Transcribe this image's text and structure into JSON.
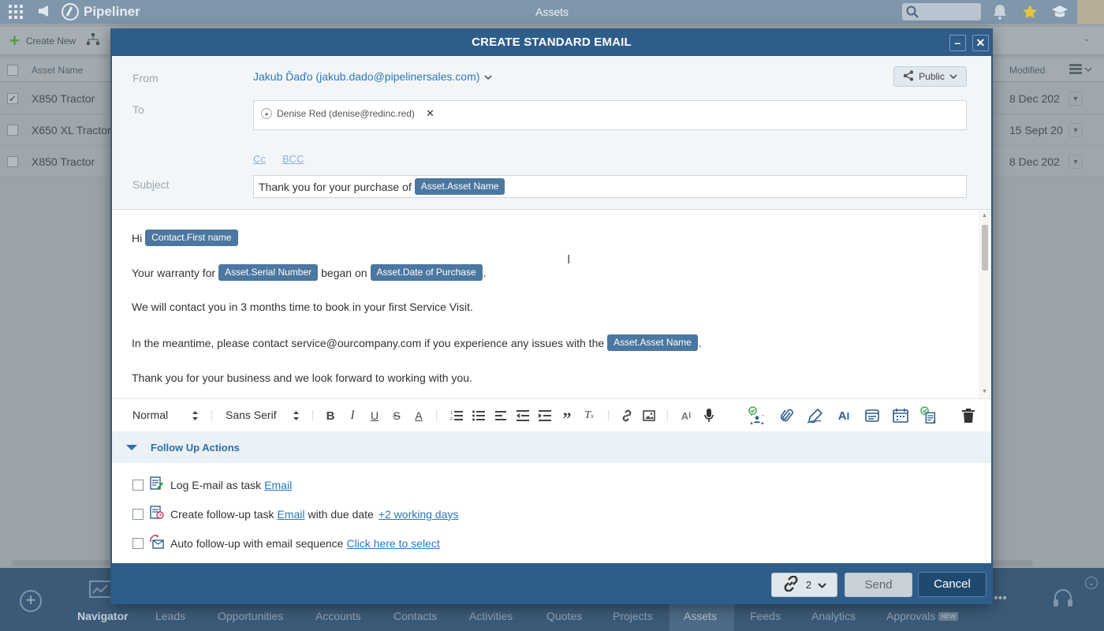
{
  "app": {
    "logo_text": "Pipeliner",
    "page_title": "Assets",
    "create_new_label": "Create New"
  },
  "grid": {
    "columns": {
      "asset_name": "Asset Name",
      "modified": "Modified"
    },
    "rows": [
      {
        "name": "X850 Tractor",
        "modified": "8 Dec 202",
        "checked": true
      },
      {
        "name": "X650 XL Tractor",
        "modified": "15 Sept 20",
        "checked": false
      },
      {
        "name": "X850 Tractor",
        "modified": "8 Dec 202",
        "checked": false
      }
    ]
  },
  "bottom_nav": {
    "items": [
      "Navigator",
      "Leads",
      "Opportunities",
      "Accounts",
      "Contacts",
      "Activities",
      "Quotes",
      "Projects",
      "Assets",
      "Feeds",
      "Analytics",
      "Approvals"
    ],
    "new_badge": "NEW",
    "active": "Assets"
  },
  "modal": {
    "title": "CREATE STANDARD EMAIL",
    "from_label": "From",
    "from_value": "Jakub Ďaďo (jakub.dado@pipelinersales.com)",
    "visibility": "Public",
    "to_label": "To",
    "to_recipient": "Denise Red (denise@redinc.red)",
    "cc_label": "Cc",
    "bcc_label": "BCC",
    "subject_label": "Subject",
    "subject_text": "Thank you for your purchase of",
    "subject_tag": "Asset.Asset Name",
    "body": {
      "greeting": "Hi",
      "greeting_tag": "Contact.First name",
      "warranty_a": "Your warranty for",
      "warranty_tag1": "Asset.Serial Number",
      "warranty_b": "began on",
      "warranty_tag2": "Asset.Date of Purchase",
      "warranty_end": ".",
      "contact_line": "We will contact you in 3 months time to book in your first Service Visit.",
      "meantime_a": "In the meantime, please contact service@ourcompany.com if you experience any issues with the",
      "meantime_tag": "Asset.Asset Name",
      "meantime_end": ".",
      "thanks_line": "Thank you for your business and we look forward to working with you."
    },
    "toolbar": {
      "paragraph_style": "Normal",
      "font_family": "Sans Serif"
    },
    "follow_up": {
      "title": "Follow Up Actions",
      "log_label": "Log E-mail as task",
      "log_link": "Email",
      "create_label": "Create follow-up task",
      "create_link": "Email",
      "create_mid": "with due date",
      "create_due": "+2 working days",
      "auto_label": "Auto follow-up with email sequence",
      "auto_link": "Click here to select"
    },
    "footer": {
      "links_count": "2",
      "send_label": "Send",
      "cancel_label": "Cancel"
    }
  },
  "colors": {
    "header_blue": "#2f5d8a",
    "tag_blue": "#4b77a0",
    "link_blue": "#2a78bd"
  }
}
